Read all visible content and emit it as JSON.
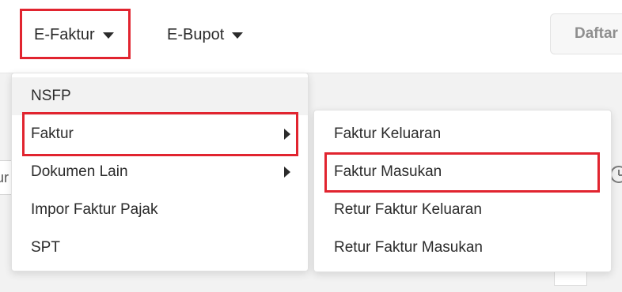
{
  "nav": {
    "efaktur_label": "E-Faktur",
    "ebupot_label": "E-Bupot",
    "daftar_label": "Daftar"
  },
  "background": {
    "left_input_text": "ur"
  },
  "menu_main": {
    "items": [
      {
        "label": "NSFP",
        "has_submenu": false
      },
      {
        "label": "Faktur",
        "has_submenu": true
      },
      {
        "label": "Dokumen Lain",
        "has_submenu": true
      },
      {
        "label": "Impor Faktur Pajak",
        "has_submenu": false
      },
      {
        "label": "SPT",
        "has_submenu": false
      }
    ]
  },
  "menu_sub": {
    "items": [
      {
        "label": "Faktur Keluaran"
      },
      {
        "label": "Faktur Masukan"
      },
      {
        "label": "Retur Faktur Keluaran"
      },
      {
        "label": "Retur Faktur Masukan"
      }
    ]
  },
  "colors": {
    "highlight": "#e1242f",
    "text": "#2b2b2b",
    "hover_bg": "#f2f2f2"
  },
  "icons": {
    "dropdown_caret": "caret-down-icon",
    "submenu_arrow": "chevron-right-icon",
    "history": "clock-icon"
  }
}
